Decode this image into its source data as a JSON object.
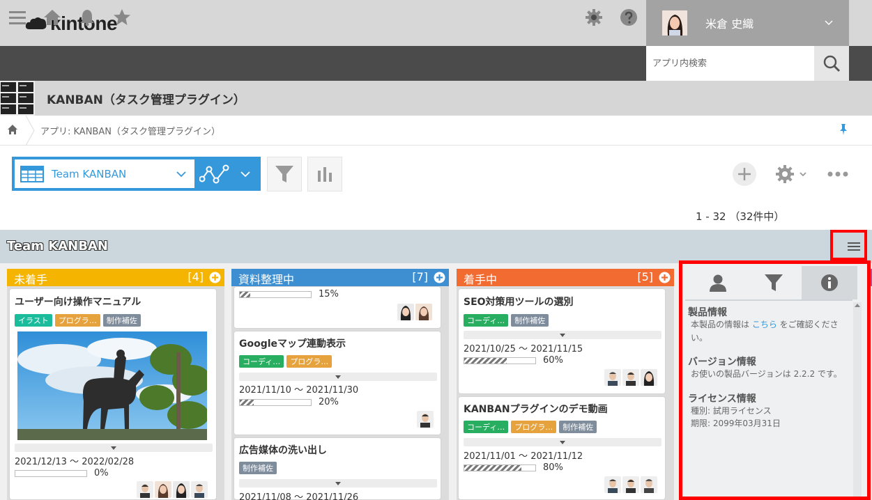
{
  "header": {
    "logo_text": "kintone",
    "user_name": "米倉 史織"
  },
  "toolbar": {
    "search_placeholder": "アプリ内検索"
  },
  "app": {
    "title": "KANBAN（タスク管理プラグイン）",
    "breadcrumb": "アプリ: KANBAN（タスク管理プラグイン）"
  },
  "view": {
    "selected": "Team KANBAN",
    "record_count": "1 - 32 （32件中）"
  },
  "board": {
    "title": "Team KANBAN",
    "columns": [
      {
        "name": "未着手",
        "count": "[4]",
        "color": "#f5b400",
        "cards": [
          {
            "title": "ユーザー向け操作マニュアル",
            "tags": [
              "イラスト",
              "プログラ…",
              "制作補佐"
            ],
            "date": "2021/12/13 ～ 2022/02/28",
            "progress": "0%",
            "progress_value": 0
          }
        ]
      },
      {
        "name": "資料整理中",
        "count": "[7]",
        "color": "#3d8fd1",
        "cards": [
          {
            "progress": "15%",
            "progress_value": 15
          },
          {
            "title": "Googleマップ連動表示",
            "tags": [
              "コーディ…",
              "プログラ…"
            ],
            "date": "2021/11/10 ～ 2021/11/30",
            "progress": "20%",
            "progress_value": 20
          },
          {
            "title": "広告媒体の洗い出し",
            "tags": [
              "制作補佐"
            ],
            "date": "2021/11/08 ～ 2021/11/26"
          }
        ]
      },
      {
        "name": "着手中",
        "count": "[5]",
        "color": "#f26b30",
        "cards": [
          {
            "title": "SEO対策用ツールの選別",
            "tags": [
              "コーディ…",
              "制作補佐"
            ],
            "date": "2021/10/25 ～ 2021/11/15",
            "progress": "60%",
            "progress_value": 60
          },
          {
            "title": "KANBANプラグインのデモ動画",
            "tags": [
              "コーディ…",
              "プログラ…",
              "制作補佐"
            ],
            "date": "2021/11/01 ～ 2021/11/12",
            "progress": "80%",
            "progress_value": 80
          }
        ]
      }
    ]
  },
  "info_panel": {
    "product_heading": "製品情報",
    "product_text_pre": "本製品の情報は ",
    "product_link": "こちら",
    "product_text_post": " をご確認ください。",
    "version_heading": "バージョン情報",
    "version_text": "お使いの製品バージョンは 2.2.2 です。",
    "license_heading": "ライセンス情報",
    "license_type": "種別: 試用ライセンス",
    "license_expiry": "期限: 2099年03月31日"
  },
  "colors": {
    "accent": "#3498db",
    "highlight": "#ff0000",
    "tag_teal": "#1abc9c",
    "tag_orange": "#e6a23c",
    "tag_gray": "#7f8c9c",
    "tag_green": "#27ae60"
  },
  "icons": [
    "menu-icon",
    "home-icon",
    "bell-icon",
    "star-icon",
    "gear-icon",
    "help-icon",
    "search-icon",
    "pin-icon",
    "filter-icon",
    "bar-chart-icon",
    "add-icon",
    "more-icon",
    "user-icon",
    "info-icon"
  ]
}
